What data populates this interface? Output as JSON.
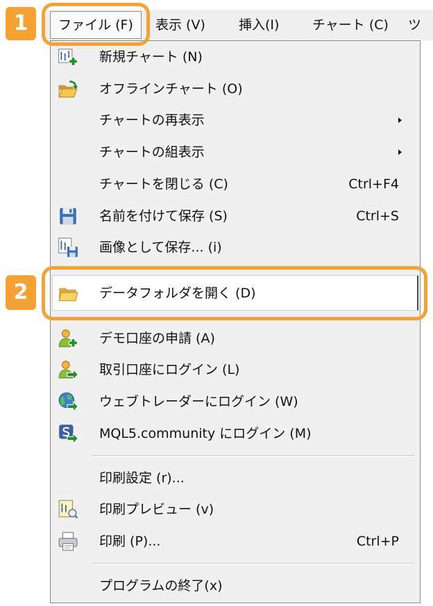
{
  "menubar": {
    "items": [
      {
        "label": "ファイル (F)",
        "active": true
      },
      {
        "label": "表示 (V)"
      },
      {
        "label": "挿入(I)"
      },
      {
        "label": "チャート (C)"
      },
      {
        "label": "ツ"
      }
    ]
  },
  "callouts": {
    "step1": "1",
    "step2": "2",
    "color": "#F3A233"
  },
  "colors": {
    "menu_background": "#F0F0F0",
    "highlight_background": "#FFFFFF",
    "accent_green": "#1F8F2A"
  },
  "file_menu": {
    "items": [
      {
        "label": "新規チャート (N)",
        "icon": "new-chart-icon"
      },
      {
        "label": "オフラインチャート (O)",
        "icon": "open-folder-icon"
      },
      {
        "label": "チャートの再表示",
        "submenu": true
      },
      {
        "label": "チャートの組表示",
        "submenu": true
      },
      {
        "label": "チャートを閉じる (C)",
        "shortcut": "Ctrl+F4"
      },
      {
        "label": "名前を付けて保存 (S)",
        "shortcut": "Ctrl+S",
        "icon": "floppy-disk-icon"
      },
      {
        "label": "画像として保存... (i)",
        "icon": "save-chart-image-icon"
      },
      {
        "label": "データフォルダを開く (D)",
        "icon": "folder-icon",
        "highlighted": true
      },
      {
        "label": "デモ口座の申請 (A)",
        "icon": "user-add-icon"
      },
      {
        "label": "取引口座にログイン (L)",
        "icon": "user-login-icon"
      },
      {
        "label": "ウェブトレーダーにログイン (W)",
        "icon": "globe-login-icon"
      },
      {
        "label": "MQL5.community にログイン (M)",
        "icon": "mql5-login-icon"
      },
      {
        "label": "印刷設定 (r)..."
      },
      {
        "label": "印刷プレビュー (v)",
        "icon": "print-preview-icon"
      },
      {
        "label": "印刷 (P)...",
        "shortcut": "Ctrl+P",
        "icon": "printer-icon"
      },
      {
        "label": "プログラムの終了(x)"
      }
    ]
  }
}
